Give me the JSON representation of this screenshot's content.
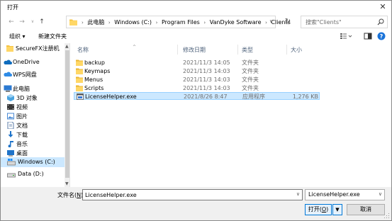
{
  "window": {
    "title": "打开",
    "close_glyph": "✕"
  },
  "address": {
    "crumbs": [
      "此电脑",
      "Windows (C:)",
      "Program Files",
      "VanDyke Software",
      "Clients"
    ],
    "separator": "›",
    "search_placeholder": "搜索\"Clients\""
  },
  "toolbar": {
    "organize_label": "组织 ▾",
    "new_folder_label": "新建文件夹"
  },
  "nav": {
    "items": [
      {
        "label": "SecureFX注册机",
        "icon": "folder-icon"
      },
      {
        "label": "OneDrive",
        "icon": "cloud-icon"
      },
      {
        "label": "WPS网盘",
        "icon": "cloud-icon"
      },
      {
        "label": "此电脑",
        "icon": "computer-icon"
      },
      {
        "label": "3D 对象",
        "icon": "cube-icon"
      },
      {
        "label": "视频",
        "icon": "video-icon"
      },
      {
        "label": "图片",
        "icon": "picture-icon"
      },
      {
        "label": "文档",
        "icon": "document-icon"
      },
      {
        "label": "下载",
        "icon": "download-icon"
      },
      {
        "label": "音乐",
        "icon": "music-icon"
      },
      {
        "label": "桌面",
        "icon": "desktop-icon"
      },
      {
        "label": "Windows (C:)",
        "icon": "drive-icon"
      },
      {
        "label": "Data (D:)",
        "icon": "drive-icon"
      }
    ]
  },
  "filelist": {
    "columns": {
      "name": "名称",
      "date": "修改日期",
      "type": "类型",
      "size": "大小"
    },
    "rows": [
      {
        "name": "backup",
        "date": "2021/11/3 14:05",
        "type": "文件夹",
        "size": "",
        "kind": "folder"
      },
      {
        "name": "Keymaps",
        "date": "2021/11/3 14:03",
        "type": "文件夹",
        "size": "",
        "kind": "folder"
      },
      {
        "name": "Menus",
        "date": "2021/11/3 14:03",
        "type": "文件夹",
        "size": "",
        "kind": "folder"
      },
      {
        "name": "Scripts",
        "date": "2021/11/3 14:03",
        "type": "文件夹",
        "size": "",
        "kind": "folder"
      },
      {
        "name": "LicenseHelper.exe",
        "date": "2021/8/26 8:47",
        "type": "应用程序",
        "size": "1,276 KB",
        "kind": "exe"
      }
    ]
  },
  "bottom": {
    "filename_label_pre": "文件名(",
    "filename_label_key": "N",
    "filename_label_post": "):",
    "filename_value": "LicenseHelper.exe",
    "filter_value": "LicenseHelper.exe",
    "open_label_pre": "打开(",
    "open_label_key": "O",
    "open_label_post": ")",
    "cancel_label": "取消"
  },
  "colors": {
    "selection_bg": "#cce8ff",
    "selection_border": "#99d1ff",
    "accent": "#0078d7",
    "folder": "#f5c342",
    "header_text": "#4c607a"
  }
}
